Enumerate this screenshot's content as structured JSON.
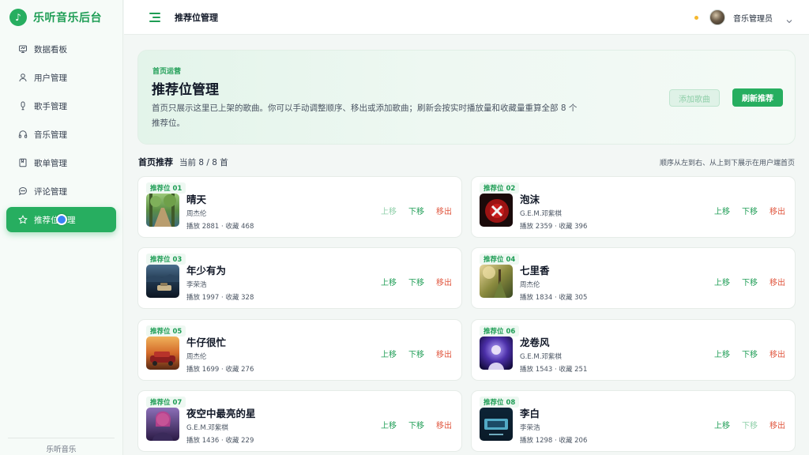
{
  "app": {
    "name": "乐听音乐后台",
    "footer": "乐听音乐"
  },
  "sidebar": {
    "items": [
      {
        "label": "数据看板",
        "icon": "dashboard-icon"
      },
      {
        "label": "用户管理",
        "icon": "user-icon"
      },
      {
        "label": "歌手管理",
        "icon": "microphone-icon"
      },
      {
        "label": "音乐管理",
        "icon": "headphones-icon"
      },
      {
        "label": "歌单管理",
        "icon": "book-icon"
      },
      {
        "label": "评论管理",
        "icon": "comment-icon"
      },
      {
        "label": "推荐位管理",
        "icon": "star-icon",
        "active": true
      }
    ]
  },
  "header": {
    "title": "推荐位管理",
    "user": "音乐管理员"
  },
  "hero": {
    "eyebrow": "首页运营",
    "title": "推荐位管理",
    "description": "首页只展示这里已上架的歌曲。你可以手动调整顺序、移出或添加歌曲；刷新会按实时播放量和收藏量重算全部 8 个推荐位。",
    "add_label": "添加歌曲",
    "refresh_label": "刷新推荐"
  },
  "section": {
    "title": "首页推荐",
    "count": "当前 8 / 8 首",
    "hint": "顺序从左到右、从上到下展示在用户端首页"
  },
  "actions": {
    "up": "上移",
    "down": "下移",
    "remove": "移出"
  },
  "cards": [
    {
      "slot": "推荐位 01",
      "title": "晴天",
      "artist": "周杰伦",
      "stats": "播放 2881 · 收藏 468",
      "up_disabled": true,
      "down_disabled": false
    },
    {
      "slot": "推荐位 02",
      "title": "泡沫",
      "artist": "G.E.M.邓紫棋",
      "stats": "播放 2359 · 收藏 396",
      "up_disabled": false,
      "down_disabled": false
    },
    {
      "slot": "推荐位 03",
      "title": "年少有为",
      "artist": "李荣浩",
      "stats": "播放 1997 · 收藏 328",
      "up_disabled": false,
      "down_disabled": false
    },
    {
      "slot": "推荐位 04",
      "title": "七里香",
      "artist": "周杰伦",
      "stats": "播放 1834 · 收藏 305",
      "up_disabled": false,
      "down_disabled": false
    },
    {
      "slot": "推荐位 05",
      "title": "牛仔很忙",
      "artist": "周杰伦",
      "stats": "播放 1699 · 收藏 276",
      "up_disabled": false,
      "down_disabled": false
    },
    {
      "slot": "推荐位 06",
      "title": "龙卷风",
      "artist": "G.E.M.邓紫棋",
      "stats": "播放 1543 · 收藏 251",
      "up_disabled": false,
      "down_disabled": false
    },
    {
      "slot": "推荐位 07",
      "title": "夜空中最亮的星",
      "artist": "G.E.M.邓紫棋",
      "stats": "播放 1436 · 收藏 229",
      "up_disabled": false,
      "down_disabled": false
    },
    {
      "slot": "推荐位 08",
      "title": "李白",
      "artist": "李荣浩",
      "stats": "播放 1298 · 收藏 206",
      "up_disabled": false,
      "down_disabled": true
    }
  ],
  "colors": {
    "accent": "#27ae60",
    "accent_dark": "#1e9d55",
    "danger": "#e0553d",
    "status": "#f5b82e"
  }
}
